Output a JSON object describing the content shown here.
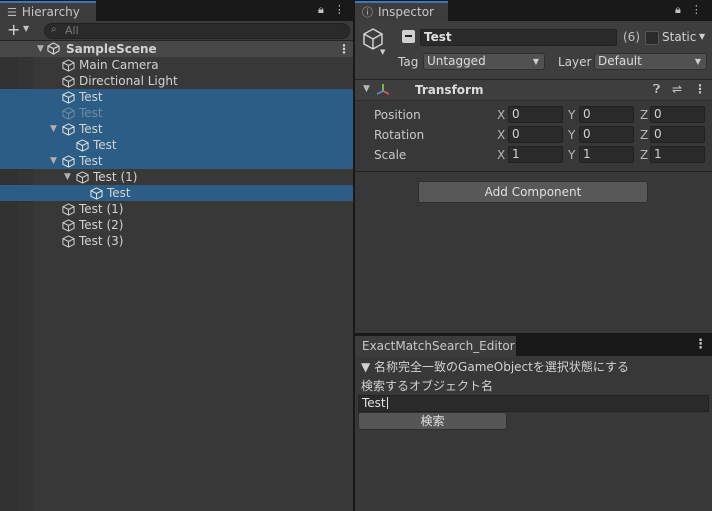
{
  "hierarchy": {
    "tab_label": "Hierarchy",
    "add_button": "+",
    "search_placeholder": "All",
    "scene": "SampleScene",
    "items": [
      {
        "label": "Main Camera"
      },
      {
        "label": "Directional Light"
      },
      {
        "label": "Test"
      },
      {
        "label": "Test"
      },
      {
        "label": "Test"
      },
      {
        "label": "Test"
      },
      {
        "label": "Test"
      },
      {
        "label": "Test (1)"
      },
      {
        "label": "Test"
      },
      {
        "label": "Test (1)"
      },
      {
        "label": "Test (2)"
      },
      {
        "label": "Test (3)"
      }
    ]
  },
  "inspector": {
    "tab_label": "Inspector",
    "object_name": "Test",
    "selection_count": "(6)",
    "static_label": "Static",
    "tag_label": "Tag",
    "tag_value": "Untagged",
    "layer_label": "Layer",
    "layer_value": "Default",
    "component_title": "Transform",
    "rows": [
      {
        "label": "Position",
        "x": "0",
        "y": "0",
        "z": "0"
      },
      {
        "label": "Rotation",
        "x": "0",
        "y": "0",
        "z": "0"
      },
      {
        "label": "Scale",
        "x": "1",
        "y": "1",
        "z": "1"
      }
    ],
    "axes": {
      "x": "X",
      "y": "Y",
      "z": "Z"
    },
    "add_component": "Add Component"
  },
  "editor": {
    "tab_label": "ExactMatchSearch_Editor",
    "foldout": "▼ 名称完全一致のGameObjectを選択状態にする",
    "field_label": "検索するオブジェクト名",
    "field_value": "Test",
    "search_button": "検索"
  },
  "colors": {
    "selection": "#2c5d87",
    "panel": "#383838",
    "accent": "#3a79bb"
  }
}
